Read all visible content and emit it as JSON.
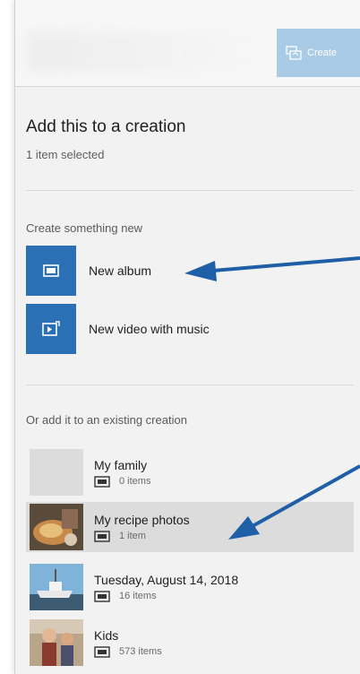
{
  "header": {
    "create_label": "Create",
    "create_icon": "create-icon"
  },
  "panel": {
    "title": "Add this to a creation",
    "subtitle": "1 item selected"
  },
  "create_new": {
    "label": "Create something new",
    "items": [
      {
        "label": "New album",
        "icon": "album-icon"
      },
      {
        "label": "New video with music",
        "icon": "video-music-icon"
      }
    ]
  },
  "existing": {
    "label": "Or add it to an existing creation",
    "items": [
      {
        "name": "My family",
        "count": "0 items",
        "selected": false
      },
      {
        "name": "My recipe photos",
        "count": "1 item",
        "selected": true
      },
      {
        "name": "Tuesday, August 14, 2018",
        "count": "16 items",
        "selected": false
      },
      {
        "name": "Kids",
        "count": "573 items",
        "selected": false
      }
    ]
  },
  "colors": {
    "accent": "#2b6fb4",
    "create_button": "#a9cbe6",
    "selected_row": "#dcdcdc",
    "annotation_arrow": "#1f5fa8"
  }
}
